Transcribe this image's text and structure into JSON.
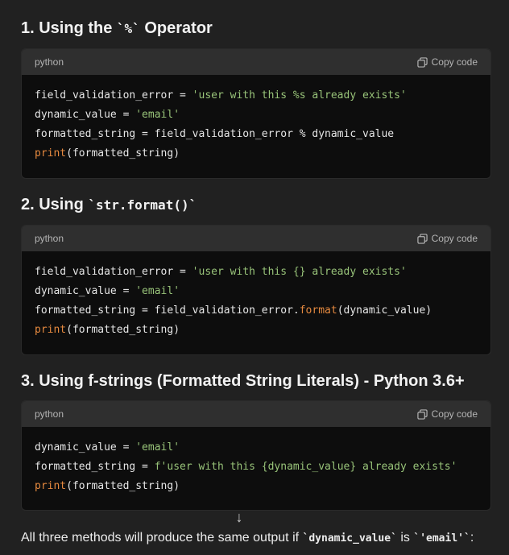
{
  "sections": [
    {
      "heading_prefix": "1. Using the ",
      "heading_code": "`%`",
      "heading_suffix": " Operator",
      "lang": "python",
      "copy_label": "Copy code",
      "lines": [
        [
          "field_validation_error = ",
          "'user with this %s already exists'"
        ],
        [
          "dynamic_value = ",
          "'email'"
        ],
        [
          "formatted_string = field_validation_error % dynamic_value"
        ],
        [
          "print",
          "(formatted_string)"
        ]
      ]
    },
    {
      "heading_prefix": "2. Using ",
      "heading_code": "`str.format()`",
      "lang": "python",
      "copy_label": "Copy code",
      "lines": [
        [
          "field_validation_error = ",
          "'user with this {} already exists'"
        ],
        [
          "dynamic_value = ",
          "'email'"
        ],
        [
          "formatted_string = field_validation_error.",
          "format",
          "(dynamic_value)"
        ],
        [
          "print",
          "(formatted_string)"
        ]
      ]
    },
    {
      "heading_prefix": "3. Using f-strings (Formatted String Literals) - Python 3.6+",
      "lang": "python",
      "copy_label": "Copy code",
      "lines": [
        [
          "dynamic_value = ",
          "'email'"
        ],
        [
          "formatted_string = ",
          "f'user with this {dynamic_value} already exists'"
        ],
        [
          "print",
          "(formatted_string)"
        ]
      ]
    }
  ],
  "footer": {
    "text_before": "All three methods will produce the same output if ",
    "code1": "`dynamic_value`",
    "text_mid": " is ",
    "code2": "`'email'`",
    "text_after": ":"
  },
  "icons": {
    "copy": "copy-icon",
    "scroll": "arrow-down-icon"
  }
}
